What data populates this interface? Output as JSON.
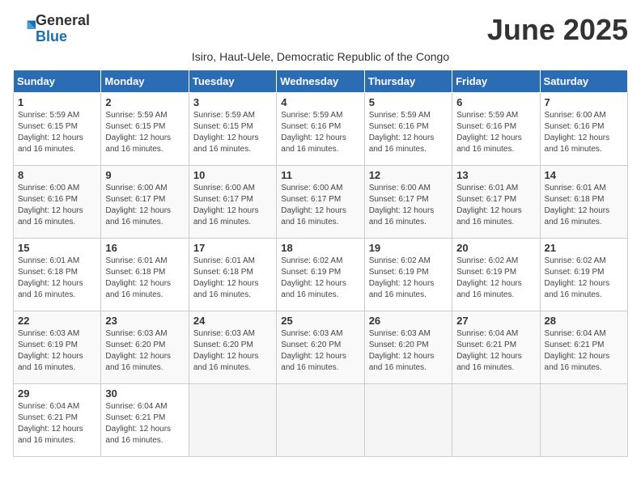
{
  "logo": {
    "general": "General",
    "blue": "Blue"
  },
  "title": "June 2025",
  "subtitle": "Isiro, Haut-Uele, Democratic Republic of the Congo",
  "headers": [
    "Sunday",
    "Monday",
    "Tuesday",
    "Wednesday",
    "Thursday",
    "Friday",
    "Saturday"
  ],
  "weeks": [
    [
      {
        "day": "1",
        "sunrise": "Sunrise: 5:59 AM",
        "sunset": "Sunset: 6:15 PM",
        "daylight": "Daylight: 12 hours and 16 minutes."
      },
      {
        "day": "2",
        "sunrise": "Sunrise: 5:59 AM",
        "sunset": "Sunset: 6:15 PM",
        "daylight": "Daylight: 12 hours and 16 minutes."
      },
      {
        "day": "3",
        "sunrise": "Sunrise: 5:59 AM",
        "sunset": "Sunset: 6:15 PM",
        "daylight": "Daylight: 12 hours and 16 minutes."
      },
      {
        "day": "4",
        "sunrise": "Sunrise: 5:59 AM",
        "sunset": "Sunset: 6:16 PM",
        "daylight": "Daylight: 12 hours and 16 minutes."
      },
      {
        "day": "5",
        "sunrise": "Sunrise: 5:59 AM",
        "sunset": "Sunset: 6:16 PM",
        "daylight": "Daylight: 12 hours and 16 minutes."
      },
      {
        "day": "6",
        "sunrise": "Sunrise: 5:59 AM",
        "sunset": "Sunset: 6:16 PM",
        "daylight": "Daylight: 12 hours and 16 minutes."
      },
      {
        "day": "7",
        "sunrise": "Sunrise: 6:00 AM",
        "sunset": "Sunset: 6:16 PM",
        "daylight": "Daylight: 12 hours and 16 minutes."
      }
    ],
    [
      {
        "day": "8",
        "sunrise": "Sunrise: 6:00 AM",
        "sunset": "Sunset: 6:16 PM",
        "daylight": "Daylight: 12 hours and 16 minutes."
      },
      {
        "day": "9",
        "sunrise": "Sunrise: 6:00 AM",
        "sunset": "Sunset: 6:17 PM",
        "daylight": "Daylight: 12 hours and 16 minutes."
      },
      {
        "day": "10",
        "sunrise": "Sunrise: 6:00 AM",
        "sunset": "Sunset: 6:17 PM",
        "daylight": "Daylight: 12 hours and 16 minutes."
      },
      {
        "day": "11",
        "sunrise": "Sunrise: 6:00 AM",
        "sunset": "Sunset: 6:17 PM",
        "daylight": "Daylight: 12 hours and 16 minutes."
      },
      {
        "day": "12",
        "sunrise": "Sunrise: 6:00 AM",
        "sunset": "Sunset: 6:17 PM",
        "daylight": "Daylight: 12 hours and 16 minutes."
      },
      {
        "day": "13",
        "sunrise": "Sunrise: 6:01 AM",
        "sunset": "Sunset: 6:17 PM",
        "daylight": "Daylight: 12 hours and 16 minutes."
      },
      {
        "day": "14",
        "sunrise": "Sunrise: 6:01 AM",
        "sunset": "Sunset: 6:18 PM",
        "daylight": "Daylight: 12 hours and 16 minutes."
      }
    ],
    [
      {
        "day": "15",
        "sunrise": "Sunrise: 6:01 AM",
        "sunset": "Sunset: 6:18 PM",
        "daylight": "Daylight: 12 hours and 16 minutes."
      },
      {
        "day": "16",
        "sunrise": "Sunrise: 6:01 AM",
        "sunset": "Sunset: 6:18 PM",
        "daylight": "Daylight: 12 hours and 16 minutes."
      },
      {
        "day": "17",
        "sunrise": "Sunrise: 6:01 AM",
        "sunset": "Sunset: 6:18 PM",
        "daylight": "Daylight: 12 hours and 16 minutes."
      },
      {
        "day": "18",
        "sunrise": "Sunrise: 6:02 AM",
        "sunset": "Sunset: 6:19 PM",
        "daylight": "Daylight: 12 hours and 16 minutes."
      },
      {
        "day": "19",
        "sunrise": "Sunrise: 6:02 AM",
        "sunset": "Sunset: 6:19 PM",
        "daylight": "Daylight: 12 hours and 16 minutes."
      },
      {
        "day": "20",
        "sunrise": "Sunrise: 6:02 AM",
        "sunset": "Sunset: 6:19 PM",
        "daylight": "Daylight: 12 hours and 16 minutes."
      },
      {
        "day": "21",
        "sunrise": "Sunrise: 6:02 AM",
        "sunset": "Sunset: 6:19 PM",
        "daylight": "Daylight: 12 hours and 16 minutes."
      }
    ],
    [
      {
        "day": "22",
        "sunrise": "Sunrise: 6:03 AM",
        "sunset": "Sunset: 6:19 PM",
        "daylight": "Daylight: 12 hours and 16 minutes."
      },
      {
        "day": "23",
        "sunrise": "Sunrise: 6:03 AM",
        "sunset": "Sunset: 6:20 PM",
        "daylight": "Daylight: 12 hours and 16 minutes."
      },
      {
        "day": "24",
        "sunrise": "Sunrise: 6:03 AM",
        "sunset": "Sunset: 6:20 PM",
        "daylight": "Daylight: 12 hours and 16 minutes."
      },
      {
        "day": "25",
        "sunrise": "Sunrise: 6:03 AM",
        "sunset": "Sunset: 6:20 PM",
        "daylight": "Daylight: 12 hours and 16 minutes."
      },
      {
        "day": "26",
        "sunrise": "Sunrise: 6:03 AM",
        "sunset": "Sunset: 6:20 PM",
        "daylight": "Daylight: 12 hours and 16 minutes."
      },
      {
        "day": "27",
        "sunrise": "Sunrise: 6:04 AM",
        "sunset": "Sunset: 6:21 PM",
        "daylight": "Daylight: 12 hours and 16 minutes."
      },
      {
        "day": "28",
        "sunrise": "Sunrise: 6:04 AM",
        "sunset": "Sunset: 6:21 PM",
        "daylight": "Daylight: 12 hours and 16 minutes."
      }
    ],
    [
      {
        "day": "29",
        "sunrise": "Sunrise: 6:04 AM",
        "sunset": "Sunset: 6:21 PM",
        "daylight": "Daylight: 12 hours and 16 minutes."
      },
      {
        "day": "30",
        "sunrise": "Sunrise: 6:04 AM",
        "sunset": "Sunset: 6:21 PM",
        "daylight": "Daylight: 12 hours and 16 minutes."
      },
      null,
      null,
      null,
      null,
      null
    ]
  ]
}
